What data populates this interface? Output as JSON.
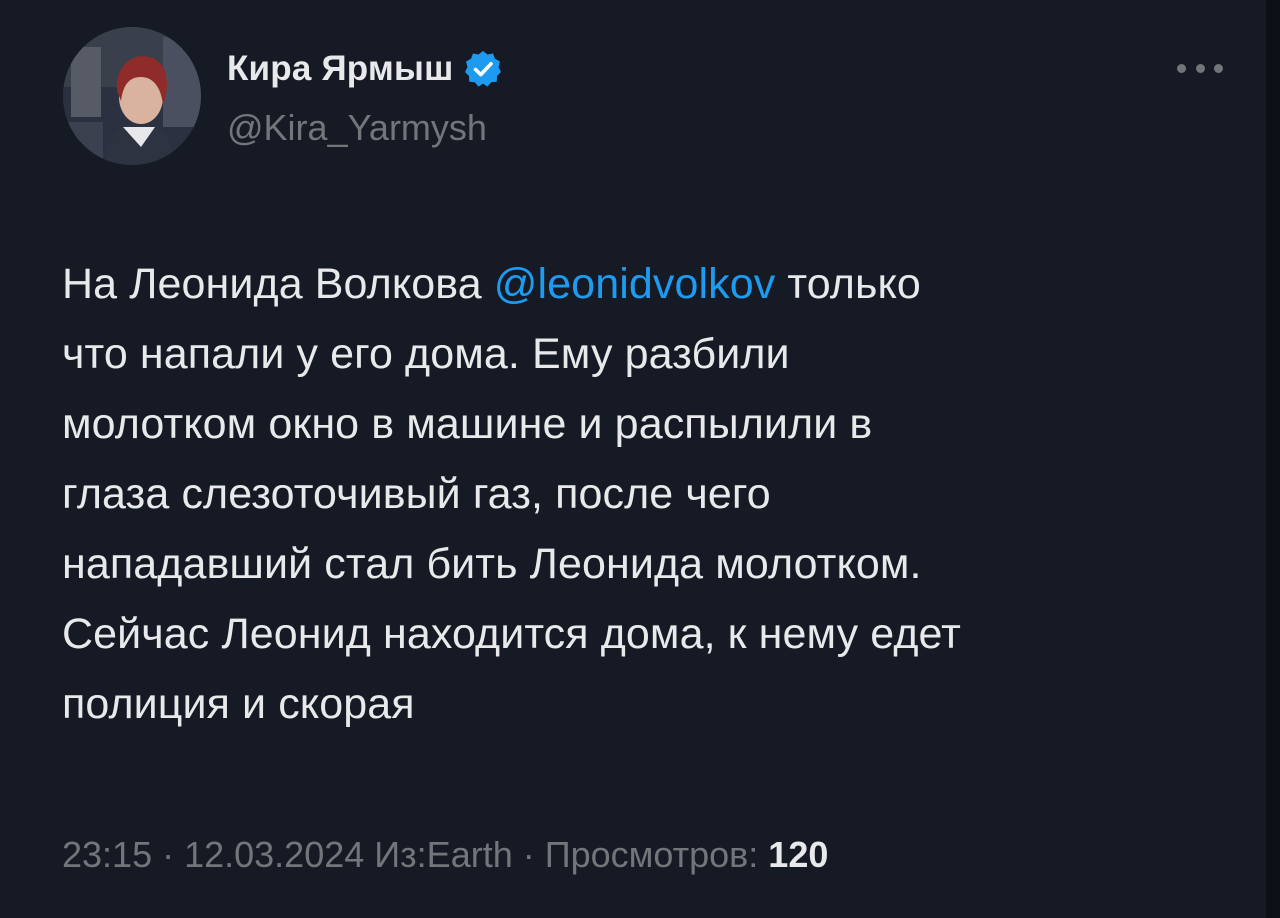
{
  "author": {
    "display_name": "Кира Ярмыш",
    "handle": "@Kira_Yarmysh",
    "verified": true
  },
  "icons": {
    "verified": "verified-badge-icon",
    "more": "more-dots-icon"
  },
  "colors": {
    "background": "#161a25",
    "text": "#e7e9ea",
    "secondary": "#71767b",
    "accent": "#1d9bf0"
  },
  "tweet": {
    "lines": [
      {
        "pre": "На Леонида Волкова ",
        "mention": "@leonidvolkov",
        "post": " только"
      },
      {
        "text": "что напали у его дома. Ему разбили"
      },
      {
        "text": "молотком окно в машине и распылили в"
      },
      {
        "text": "глаза слезоточивый газ, после чего"
      },
      {
        "text": "нападавший стал бить Леонида молотком."
      },
      {
        "text": "Сейчас Леонид находится дома, к нему едет"
      },
      {
        "text": "полиция и скорая"
      }
    ]
  },
  "meta": {
    "time": "23:15",
    "sep1": " · ",
    "date": "12.03.2024",
    "sep2": " ",
    "source": "Из:Earth",
    "sep3": " · ",
    "views_label": "Просмотров: ",
    "views_count": "120"
  }
}
